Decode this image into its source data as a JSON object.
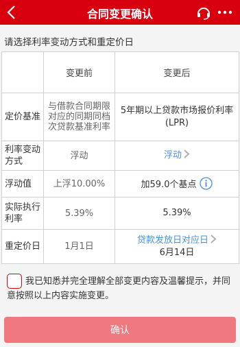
{
  "header": {
    "title": "合同变更确认",
    "background": "#d8000f"
  },
  "section_title": "请选择利率变动方式和重定价日",
  "table": {
    "headers": [
      "",
      "变更前",
      "变更后"
    ],
    "rows": [
      {
        "label": "定价基准",
        "old": "与借款合同期限对应的同期同档次贷款基准利率",
        "new": "5年期以上贷款市场报价利率(LPR)"
      },
      {
        "label": "利率变动方式",
        "old": "浮动",
        "new": "浮动"
      },
      {
        "label": "浮动值",
        "old": "上浮10.00%",
        "new": "加59.0个基点"
      },
      {
        "label": "实际执行利率",
        "old": "5.39%",
        "new": "5.39%"
      },
      {
        "label": "重定价日",
        "old": "1月1日",
        "new_link": "贷款发放日对应日",
        "new": "6月14日"
      }
    ]
  },
  "agreement": {
    "text": "我已知悉并完全理解全部变更内容及温馨提示，并同意按照以上内容实施变更。",
    "checked": false
  },
  "confirm_button": "确认",
  "icons": [
    "back-arrow-icon",
    "headset-service-icon",
    "more-dots-icon",
    "chevron-right-icon",
    "info-icon"
  ],
  "colors": {
    "accent": "#d8000f",
    "link": "#4a90d9",
    "button": "#f0787f"
  }
}
